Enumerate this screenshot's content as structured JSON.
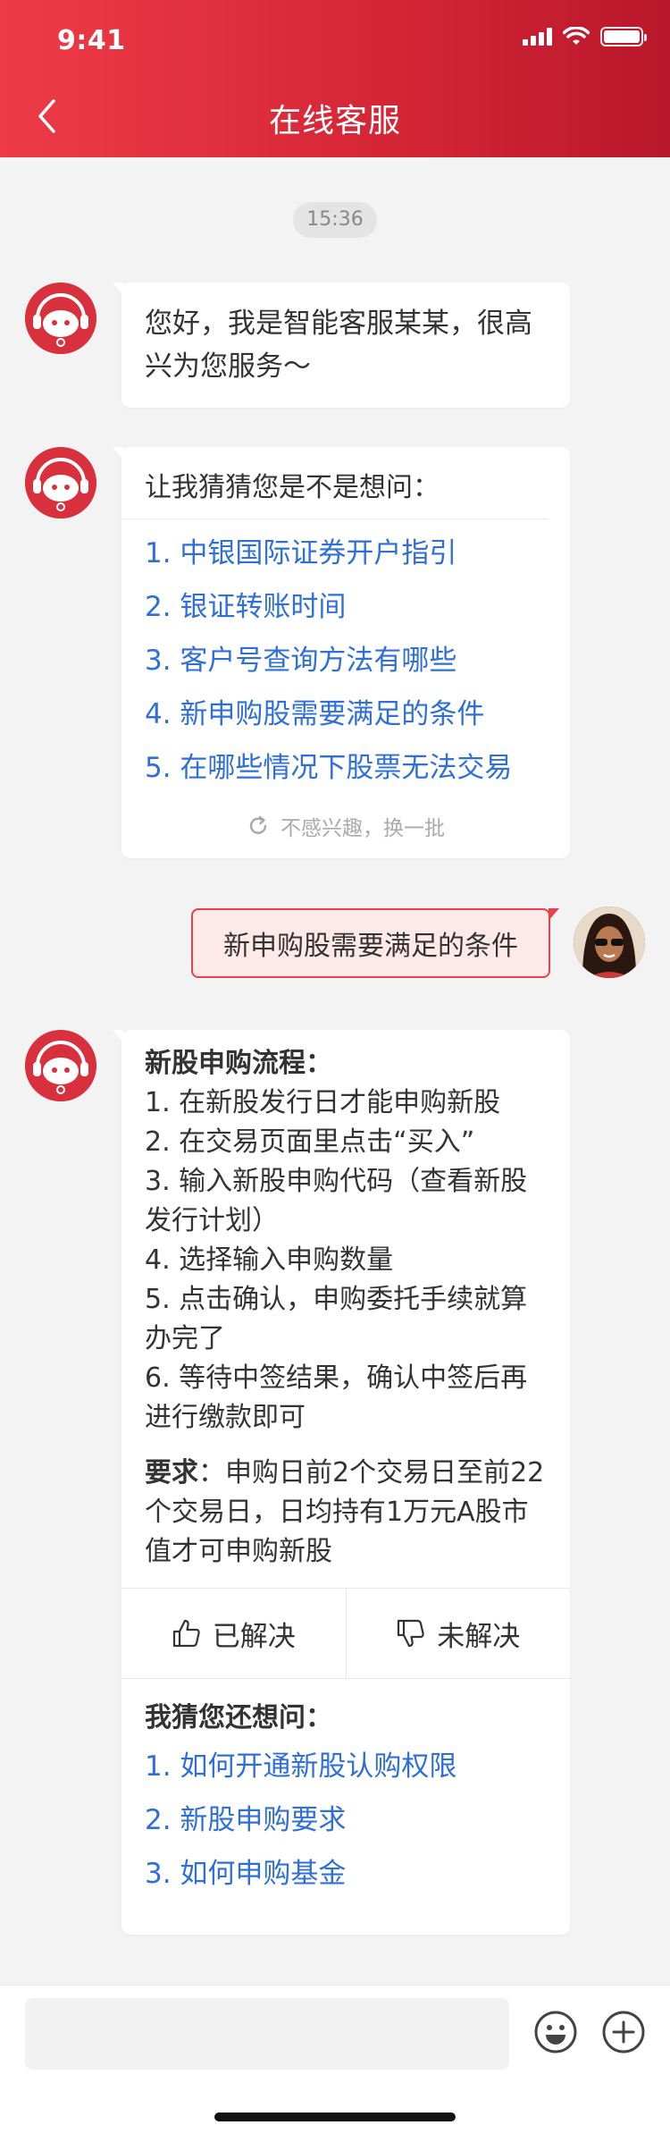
{
  "status_bar": {
    "time": "9:41"
  },
  "header": {
    "title": "在线客服"
  },
  "chat": {
    "timestamp": "15:36",
    "greeting": "您好，我是智能客服某某，很高兴为您服务～",
    "suggestions": {
      "heading": "让我猜猜您是不是想问：",
      "items": [
        "1. 中银国际证券开户指引",
        "2. 银证转账时间",
        "3. 客户号查询方法有哪些",
        "4. 新申购股需要满足的条件",
        "5. 在哪些情况下股票无法交易"
      ],
      "refresh_label": "不感兴趣，换一批"
    },
    "user_message": "新申购股需要满足的条件",
    "answer": {
      "title": "新股申购流程：",
      "steps": [
        "1. 在新股发行日才能申购新股",
        "2. 在交易页面里点击“买入”",
        "3. 输入新股申购代码（查看新股发行计划）",
        "4. 选择输入申购数量",
        "5. 点击确认，申购委托手续就算办完了",
        "6. 等待中签结果，确认中签后再进行缴款即可"
      ],
      "requirement_label": "要求",
      "requirement_text": "：申购日前2个交易日至前22个交易日，日均持有1万元A股市值才可申购新股",
      "solved_label": "已解决",
      "unsolved_label": "未解决",
      "more_heading": "我猜您还想问：",
      "more_items": [
        "1. 如何开通新股认购权限",
        "2. 新股申购要求",
        "3. 如何申购基金"
      ]
    }
  },
  "footer": {
    "input_placeholder": ""
  },
  "icons": {
    "back": "chevron-left-icon",
    "refresh": "refresh-icon",
    "thumbs_up": "thumbs-up-icon",
    "thumbs_down": "thumbs-down-icon",
    "emoji": "emoji-icon",
    "add": "plus-icon"
  },
  "colors": {
    "brand": "#d42535",
    "link": "#2f6fd8",
    "user_bubble_bg": "#fde9ea",
    "user_bubble_border": "#e4434e"
  }
}
